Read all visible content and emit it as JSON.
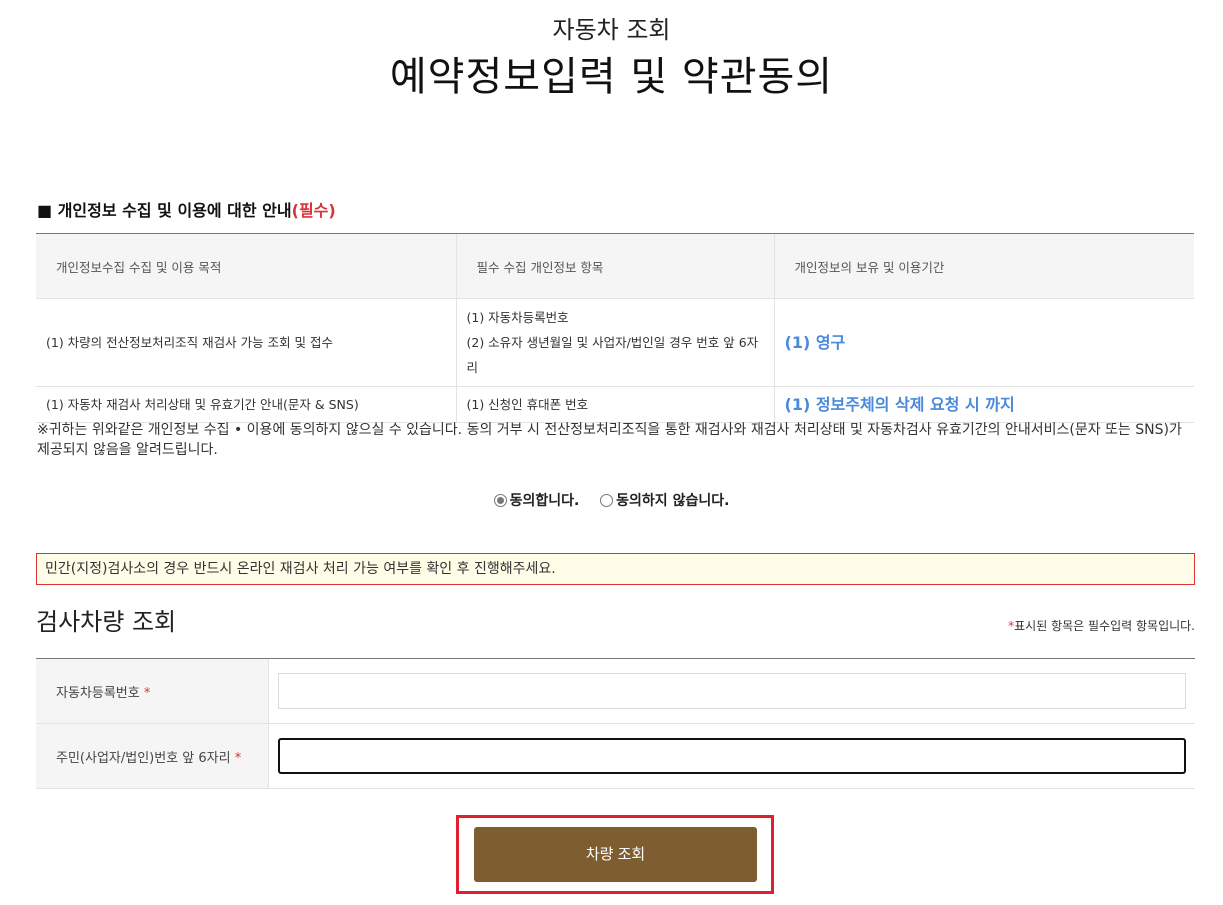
{
  "header": {
    "subtitle": "자동차 조회",
    "title": "예약정보입력 및 약관동의"
  },
  "privacy": {
    "heading": "■ 개인정보 수집 및 이용에 대한 안내",
    "required": "(필수)",
    "columns": [
      "개인정보수집 수집 및 이용 목적",
      "필수 수집 개인정보 항목",
      "개인정보의 보유 및 이용기간"
    ],
    "rows": [
      {
        "purpose": "(1) 차량의 전산정보처리조직 재검사 가능 조회 및 접수",
        "item_1": "(1) 자동차등록번호",
        "item_2": "(2) 소유자 생년월일 및 사업자/법인일 경우 번호 앞 6자리",
        "period": "(1) 영구"
      },
      {
        "purpose": "(1) 자동차 재검사 처리상태 및 유효기간 안내(문자 & SNS)",
        "item_1": "(1) 신청인 휴대폰 번호",
        "period": "(1) 정보주체의 삭제 요청 시 까지"
      }
    ],
    "notice": "※귀하는 위와같은 개인정보 수집 • 이용에 동의하지 않으실 수 있습니다. 동의 거부 시 전산정보처리조직을 통한 재검사와 재검사 처리상태 및 자동차검사 유효기간의 안내서비스(문자 또는 SNS)가 제공되지 않음을 알려드립니다."
  },
  "consent": {
    "agree_label": "동의합니다.",
    "disagree_label": "동의하지 않습니다.",
    "selected": "agree"
  },
  "alert": {
    "text": "민간(지정)검사소의 경우 반드시 온라인 재검사 처리 가능 여부를 확인 후 진행해주세요."
  },
  "inquiry": {
    "title": "검사차량 조회",
    "required_note": "표시된 항목은 필수입력 항목입니다.",
    "required_mark": "*",
    "fields": [
      {
        "label": "자동차등록번호",
        "value": "",
        "placeholder": ""
      },
      {
        "label": "주민(사업자/법인)번호 앞 6자리",
        "value": "",
        "placeholder": ""
      }
    ],
    "submit_label": "차량 조회"
  },
  "colors": {
    "button_bg": "#7e5e31",
    "accent_red": "#d9343a",
    "period_blue": "#4a89dc",
    "alert_bg": "#fffde7"
  }
}
